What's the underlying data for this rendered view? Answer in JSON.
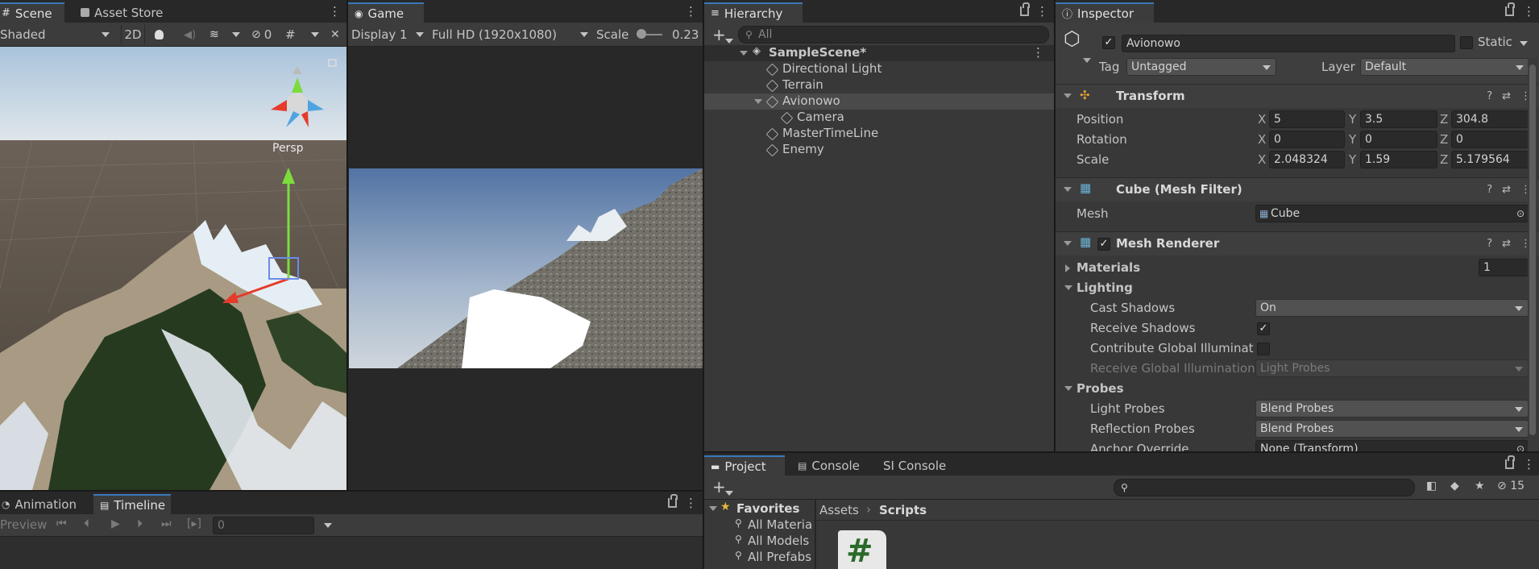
{
  "scene": {
    "tabs": [
      "Scene",
      "Asset Store"
    ],
    "shading": "Shaded",
    "btn_2d": "2D",
    "hidden_count": "0",
    "persp": "Persp"
  },
  "game": {
    "tab": "Game",
    "display": "Display 1",
    "resolution": "Full HD (1920x1080)",
    "scale_label": "Scale",
    "scale_value": "0.23"
  },
  "hierarchy": {
    "tab": "Hierarchy",
    "search_placeholder": "All",
    "items": [
      "SampleScene*",
      "Directional Light",
      "Terrain",
      "Avionowo",
      "Camera",
      "MasterTimeLine",
      "Enemy"
    ]
  },
  "inspector": {
    "tab": "Inspector",
    "object_name": "Avionowo",
    "static_label": "Static",
    "tag_label": "Tag",
    "tag_value": "Untagged",
    "layer_label": "Layer",
    "layer_value": "Default",
    "transform": {
      "title": "Transform",
      "position_label": "Position",
      "position": {
        "x": "5",
        "y": "3.5",
        "z": "304.8"
      },
      "rotation_label": "Rotation",
      "rotation": {
        "x": "0",
        "y": "0",
        "z": "0"
      },
      "scale_label": "Scale",
      "scale": {
        "x": "2.048324",
        "y": "1.59",
        "z": "5.179564"
      },
      "axis_x": "X",
      "axis_y": "Y",
      "axis_z": "Z"
    },
    "mesh_filter": {
      "title": "Cube (Mesh Filter)",
      "mesh_label": "Mesh",
      "mesh_value": "Cube"
    },
    "mesh_renderer": {
      "title": "Mesh Renderer",
      "materials_label": "Materials",
      "materials_count": "1",
      "lighting_label": "Lighting",
      "cast_shadows_label": "Cast Shadows",
      "cast_shadows_value": "On",
      "receive_shadows_label": "Receive Shadows",
      "contribute_gi_label": "Contribute Global Illuminatic",
      "receive_gi_label": "Receive Global Illumination",
      "receive_gi_value": "Light Probes",
      "probes_label": "Probes",
      "light_probes_label": "Light Probes",
      "light_probes_value": "Blend Probes",
      "reflection_probes_label": "Reflection Probes",
      "reflection_probes_value": "Blend Probes",
      "anchor_override_label": "Anchor Override",
      "anchor_override_value": "None (Transform)"
    }
  },
  "animation": {
    "tabs": [
      "Animation",
      "Timeline"
    ],
    "preview": "Preview",
    "frame": "0"
  },
  "project": {
    "tabs": [
      "Project",
      "Console",
      "SI Console"
    ],
    "hidden_count": "15",
    "favorites": "Favorites",
    "favorite_items": [
      "All Materia",
      "All Models",
      "All Prefabs"
    ],
    "breadcrumb": [
      "Assets",
      "Scripts"
    ],
    "script_glyph": "#"
  },
  "colors": {
    "accent": "#3a79bb",
    "panel": "#383838",
    "header": "#282828",
    "field": "#2a2a2a",
    "selection": "#4a4a4a"
  }
}
